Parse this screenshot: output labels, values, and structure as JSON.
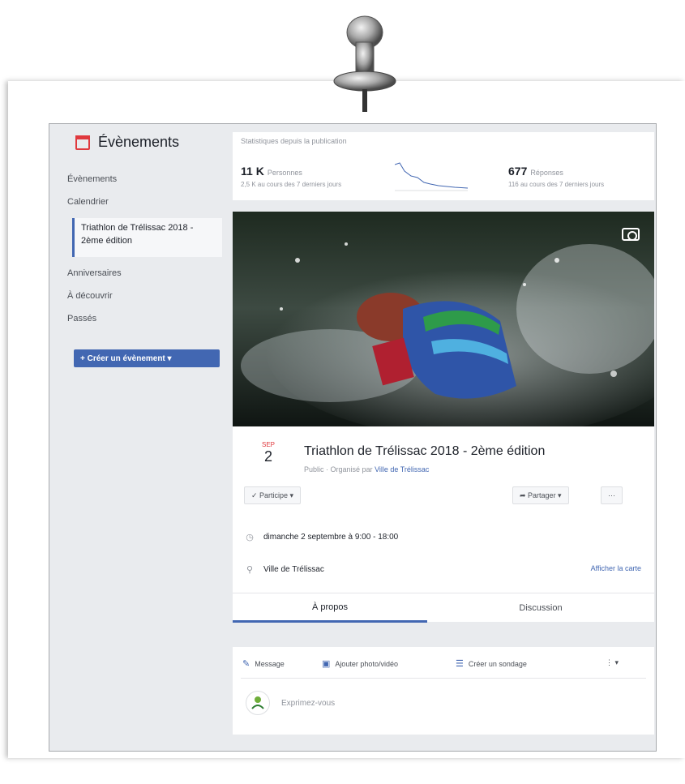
{
  "sidebar": {
    "title": "Évènements",
    "items": [
      "Évènements",
      "Calendrier",
      "Anniversaires",
      "À découvrir",
      "Passés"
    ],
    "active_item": "Triathlon de Trélissac 2018 - 2ème édition",
    "create_button": "+ Créer un évènement ▾"
  },
  "stats": {
    "header": "Statistiques depuis la publication",
    "reach_value": "11 K",
    "reach_label": "Personnes",
    "reach_sub": "2,5 K au cours des 7 derniers jours",
    "responses_value": "677",
    "responses_label": "Réponses",
    "responses_sub": "116 au cours des 7 derniers jours"
  },
  "event": {
    "month": "SEP",
    "day": "2",
    "title": "Triathlon de Trélissac 2018 - 2ème édition",
    "subtitle_prefix": "Public · Organisé par",
    "organizer": "Ville de Trélissac",
    "going_button": "✓ Participe ▾",
    "share_button": "➦ Partager ▾",
    "more_button": "···",
    "datetime": "dimanche 2 septembre à 9:00 - 18:00",
    "location": "Ville de Trélissac",
    "map_link": "Afficher la carte"
  },
  "tabs": {
    "about": "À propos",
    "discussion": "Discussion"
  },
  "composer": {
    "message": "Message",
    "photo": "Ajouter photo/vidéo",
    "poll": "Créer un sondage",
    "placeholder": "Exprimez-vous",
    "more": "⋮ ▾"
  },
  "colors": {
    "accent": "#4267b2",
    "calendar_red": "#e0393e",
    "background": "#e9ebee"
  },
  "icons": [
    "pushpin-icon",
    "calendar-icon",
    "camera-icon",
    "clock-icon",
    "location-pin-icon",
    "pencil-icon",
    "photo-icon",
    "poll-icon",
    "avatar-logo"
  ]
}
